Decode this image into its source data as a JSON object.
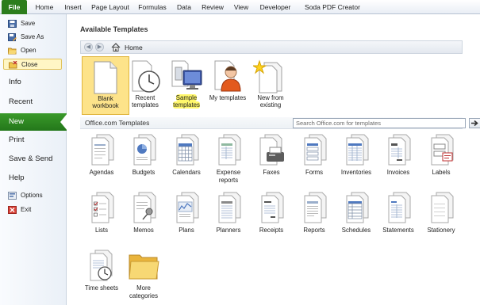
{
  "ribbon": {
    "tabs": [
      "File",
      "Home",
      "Insert",
      "Page Layout",
      "Formulas",
      "Data",
      "Review",
      "View",
      "Developer",
      "Soda PDF Creator"
    ]
  },
  "backstage": {
    "commands": [
      {
        "label": "Save",
        "icon": "save-icon"
      },
      {
        "label": "Save As",
        "icon": "save-as-icon"
      },
      {
        "label": "Open",
        "icon": "open-folder-icon"
      },
      {
        "label": "Close",
        "icon": "close-folder-icon"
      }
    ],
    "sections": [
      "Info",
      "Recent",
      "New",
      "Print",
      "Save & Send",
      "Help"
    ],
    "bottom": [
      {
        "label": "Options",
        "icon": "options-icon"
      },
      {
        "label": "Exit",
        "icon": "exit-icon"
      }
    ],
    "active_section": "New"
  },
  "main": {
    "heading": "Available Templates",
    "nav": {
      "location": "Home"
    },
    "top_templates": [
      {
        "line1": "Blank",
        "line2": "workbook"
      },
      {
        "line1": "Recent",
        "line2": "templates"
      },
      {
        "line1": "Sample",
        "line2": "templates"
      },
      {
        "line1": "My templates",
        "line2": ""
      },
      {
        "line1": "New from",
        "line2": "existing"
      }
    ],
    "office_section": {
      "label": "Office.com Templates",
      "search_placeholder": "Search Office.com for templates"
    },
    "categories": [
      {
        "line1": "Agendas",
        "line2": ""
      },
      {
        "line1": "Budgets",
        "line2": ""
      },
      {
        "line1": "Calendars",
        "line2": ""
      },
      {
        "line1": "Expense",
        "line2": "reports"
      },
      {
        "line1": "Faxes",
        "line2": ""
      },
      {
        "line1": "Forms",
        "line2": ""
      },
      {
        "line1": "Inventories",
        "line2": ""
      },
      {
        "line1": "Invoices",
        "line2": ""
      },
      {
        "line1": "Labels",
        "line2": ""
      },
      {
        "line1": "Lists",
        "line2": ""
      },
      {
        "line1": "Memos",
        "line2": ""
      },
      {
        "line1": "Plans",
        "line2": ""
      },
      {
        "line1": "Planners",
        "line2": ""
      },
      {
        "line1": "Receipts",
        "line2": ""
      },
      {
        "line1": "Reports",
        "line2": ""
      },
      {
        "line1": "Schedules",
        "line2": ""
      },
      {
        "line1": "Statements",
        "line2": ""
      },
      {
        "line1": "Stationery",
        "line2": ""
      },
      {
        "line1": "Time sheets",
        "line2": ""
      },
      {
        "line1": "More",
        "line2": "categories"
      }
    ]
  },
  "colors": {
    "accent_green": "#2c7d1c",
    "selection_yellow": "#fde38a",
    "highlight_yellow": "#fff76b"
  }
}
